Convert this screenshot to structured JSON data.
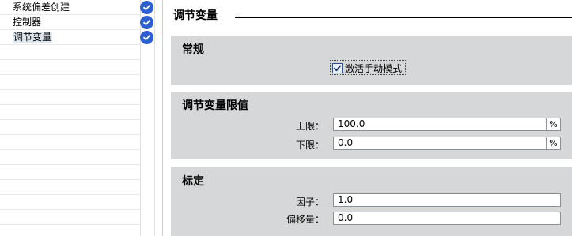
{
  "nav": {
    "items": [
      {
        "label": "系统偏差创建",
        "status_icon": "check-circle-icon"
      },
      {
        "label": "控制器",
        "status_icon": "check-circle-icon"
      },
      {
        "label": "调节变量",
        "status_icon": "check-circle-icon",
        "selected": true
      }
    ]
  },
  "content": {
    "title": "调节变量",
    "general": {
      "title": "常规",
      "manual_mode_label": "激活手动模式",
      "manual_mode_checked": true
    },
    "limits": {
      "title": "调节变量限值",
      "upper_label": "上限：",
      "upper_value": "100.0",
      "upper_unit": "%",
      "lower_label": "下限：",
      "lower_value": "0.0",
      "lower_unit": "%"
    },
    "scaling": {
      "title": "标定",
      "factor_label": "因子：",
      "factor_value": "1.0",
      "offset_label": "偏移量：",
      "offset_value": "0.0"
    }
  },
  "colors": {
    "check_blue": "#2e5fd1",
    "group_bg": "#d6d7d8",
    "selection_bg": "#dfe7ef"
  }
}
